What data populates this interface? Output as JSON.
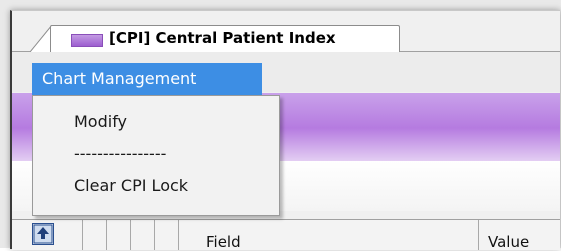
{
  "tab": {
    "title": "[CPI] Central Patient Index",
    "color": "#a86bd8"
  },
  "menu": {
    "title": "Chart Management",
    "highlight_color": "#3d8ee4",
    "items": [
      {
        "label": "Modify"
      },
      {
        "label": "----------------"
      },
      {
        "label": "Clear CPI Lock"
      }
    ]
  },
  "grid": {
    "columns": [
      {
        "label": "Field"
      },
      {
        "label": "Value"
      }
    ],
    "icon": "grid-toggle-icon"
  }
}
